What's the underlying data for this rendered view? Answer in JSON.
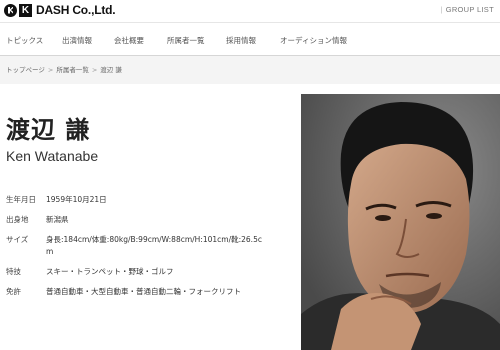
{
  "header": {
    "logo_letter": "K",
    "logo_text": "DASH Co.,Ltd.",
    "group_list": "GROUP LIST"
  },
  "nav": {
    "items": [
      {
        "label": "トピックス"
      },
      {
        "label": "出演情報"
      },
      {
        "label": "会社概要"
      },
      {
        "label": "所属者一覧"
      },
      {
        "label": "採用情報"
      },
      {
        "label": "オーディション情報"
      }
    ]
  },
  "breadcrumb": {
    "items": [
      "トップページ",
      "所属者一覧",
      "渡辺 謙"
    ],
    "separator": ">"
  },
  "profile": {
    "name_jp": "渡辺 謙",
    "name_en": "Ken Watanabe",
    "rows": [
      {
        "label": "生年月日",
        "value": "1959年10月21日"
      },
      {
        "label": "出身地",
        "value": "新潟県"
      },
      {
        "label": "サイズ",
        "value": "身長:184cm/体重:80kg/B:99cm/W:88cm/H:101cm/靴:26.5c"
      },
      {
        "label": "",
        "value": "m"
      },
      {
        "label": "特技",
        "value": "スキー・トランペット・野球・ゴルフ"
      },
      {
        "label": "免許",
        "value": "普通自動車・大型自動車・普通自動二輪・フォークリフト"
      }
    ]
  },
  "colors": {
    "page_bg": "#f4f4f4",
    "nav_bg": "#ffffff",
    "text": "#333333"
  }
}
